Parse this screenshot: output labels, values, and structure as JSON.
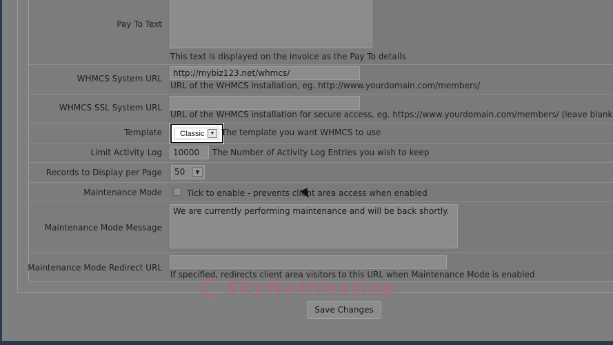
{
  "form": {
    "pay_to_text": {
      "label": "Pay To Text",
      "value": "",
      "help": "This text is displayed on the invoice as the Pay To details"
    },
    "system_url": {
      "label": "WHMCS System URL",
      "value": "http://mybiz123.net/whmcs/",
      "help": "URL of the WHMCS installation, eg. http://www.yourdomain.com/members/"
    },
    "ssl_system_url": {
      "label": "WHMCS SSL System URL",
      "value": "",
      "help": "URL of the WHMCS installation for secure access, eg. https://www.yourdomain.com/members/ (leave blank for no SS"
    },
    "template": {
      "label": "Template",
      "selected": "Classic",
      "help": "The template you want WHMCS to use"
    },
    "activity_log": {
      "label": "Limit Activity Log",
      "value": "10000",
      "help": "The Number of Activity Log Entries you wish to keep"
    },
    "records_per_page": {
      "label": "Records to Display per Page",
      "selected": "50"
    },
    "maintenance_mode": {
      "label": "Maintenance Mode",
      "checked": false,
      "help": "Tick to enable - prevents client area access when enabled"
    },
    "maintenance_message": {
      "label": "Maintenance Mode Message",
      "value": "We are currently performing maintenance and will be back shortly."
    },
    "maintenance_redirect": {
      "label": "Maintenance Mode Redirect URL",
      "value": "",
      "help": "If specified, redirects client area visitors to this URL when Maintenance Mode is enabled"
    }
  },
  "actions": {
    "save_label": "Save Changes"
  },
  "watermark": {
    "text": "SkyNetHosting"
  },
  "icons": {
    "dropdown": "chevron-down-icon",
    "cursor": "mouse-pointer-icon",
    "resize": "resize-grip-icon"
  },
  "colors": {
    "overlay": "#7d7f81",
    "frame": "#2c3a4c",
    "watermark": "#b8627a"
  }
}
